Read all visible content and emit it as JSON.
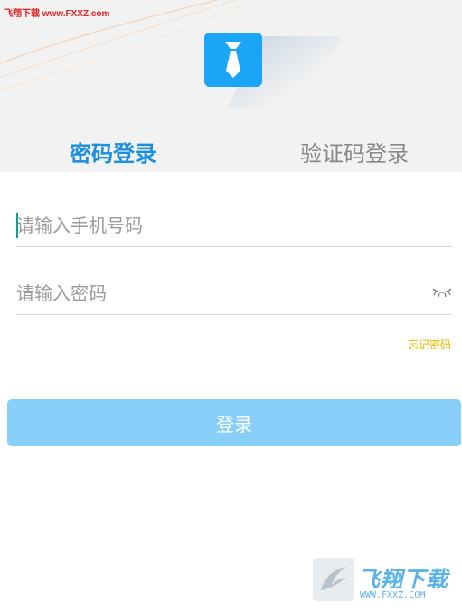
{
  "watermark_top": "飞翔下载 www.FXXZ.com",
  "tabs": [
    {
      "label": "密码登录",
      "active": true
    },
    {
      "label": "验证码登录",
      "active": false
    }
  ],
  "form": {
    "phone_placeholder": "请输入手机号码",
    "password_placeholder": "请输入密码",
    "forgot_label": "忘记密码",
    "login_label": "登录"
  },
  "icons": {
    "logo": "tie-icon",
    "password_toggle": "eye-closed-icon"
  },
  "colors": {
    "brand": "#1aa5f7",
    "active_tab": "#1a8fdf",
    "button": "#87cff8",
    "forgot": "#e6b800"
  },
  "watermark_bottom": {
    "brand": "飞翔下载",
    "url": "WWW.FXXZ.COM"
  }
}
